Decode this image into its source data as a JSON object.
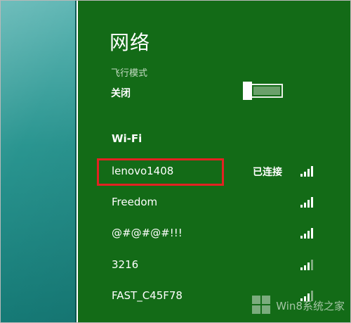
{
  "panel": {
    "title": "网络",
    "airplane_mode": {
      "label": "飞行模式",
      "state": "关闭"
    },
    "wifi_heading": "Wi-Fi",
    "networks": [
      {
        "name": "lenovo1408",
        "status": "已连接",
        "signal_bars": 4
      },
      {
        "name": "Freedom",
        "status": "",
        "signal_bars": 4
      },
      {
        "name": "@#@#@#!!!",
        "status": "",
        "signal_bars": 4
      },
      {
        "name": "3216",
        "status": "",
        "signal_bars": 3
      },
      {
        "name": "FAST_C45F78",
        "status": "",
        "signal_bars": 3
      }
    ]
  },
  "watermark": {
    "text": "Win8系统之家"
  },
  "colors": {
    "panel_bg": "#136b17",
    "desktop_bg": "#2a9590",
    "highlight": "#e32222",
    "text": "#ffffff"
  }
}
